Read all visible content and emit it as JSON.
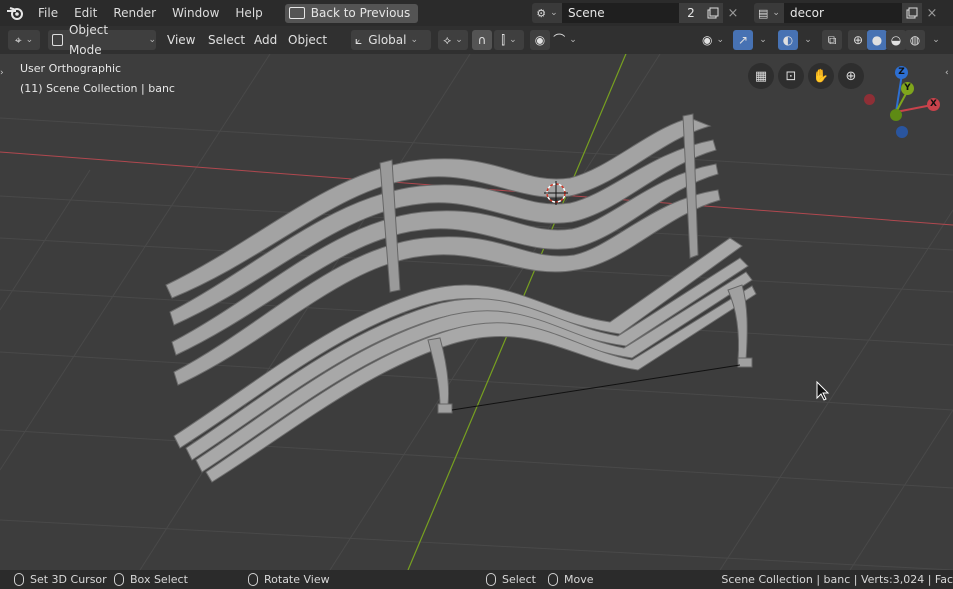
{
  "topbar": {
    "menus": [
      "File",
      "Edit",
      "Render",
      "Window",
      "Help"
    ],
    "back_label": "Back to Previous",
    "scene_name": "Scene",
    "scene_users": "2",
    "view_layer": "decor"
  },
  "header": {
    "mode": "Object Mode",
    "menus": [
      "View",
      "Select",
      "Add",
      "Object"
    ],
    "orientation": "Global"
  },
  "viewport": {
    "view_name": "User Orthographic",
    "collection_info": "(11) Scene Collection | banc",
    "gizmo": {
      "z": "Z",
      "y": "Y",
      "x": "X"
    },
    "colors": {
      "x_axis": "#c8424b",
      "y_axis": "#7fa51c",
      "z_axis": "#2d6fd2",
      "background": "#3d3d3d"
    }
  },
  "status": {
    "cursor": "Set 3D Cursor",
    "box_select": "Box Select",
    "rotate": "Rotate View",
    "select": "Select",
    "move": "Move",
    "stats": "Scene Collection | banc | Verts:3,024 | Fac"
  }
}
